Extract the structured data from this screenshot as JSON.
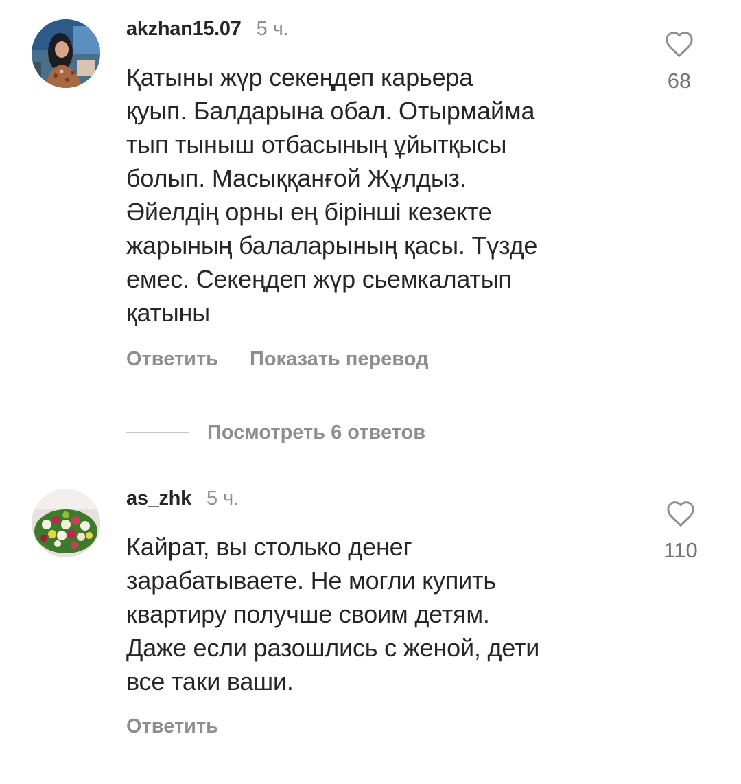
{
  "comments": [
    {
      "username": "akzhan15.07",
      "time": "5 ч.",
      "text": "Қатыны жүр секеңдеп карьера\nқуып. Балдарына обал. Отырмайма\nтып тыныш отбасының ұйытқысы\nболып. Масыққанғой Жұлдыз.\nӘйелдің орны ең бірінші кезекте\nжарының балаларының қасы. Түзде\nемес. Секеңдеп жүр сьемкалатып\nқатыны",
      "likes": "68",
      "reply_label": "Ответить",
      "translate_label": "Показать перевод",
      "view_replies_label": "Посмотреть 6 ответов",
      "avatar_icon": "user-photo-woman"
    },
    {
      "username": "as_zhk",
      "time": "5 ч.",
      "text": "Кайрат, вы столько денег\nзарабатываете. Не могли купить\nквартиру получше своим детям.\nДаже если разошлись с женой, дети\nвсе таки ваши.",
      "likes": "110",
      "reply_label": "Ответить",
      "avatar_icon": "user-photo-flowers"
    }
  ],
  "icons": {
    "like": "heart-outline-icon"
  },
  "colors": {
    "primary_text": "#262626",
    "secondary_text": "#8e8e8e",
    "divider": "#c7c7c7",
    "background": "#ffffff"
  }
}
